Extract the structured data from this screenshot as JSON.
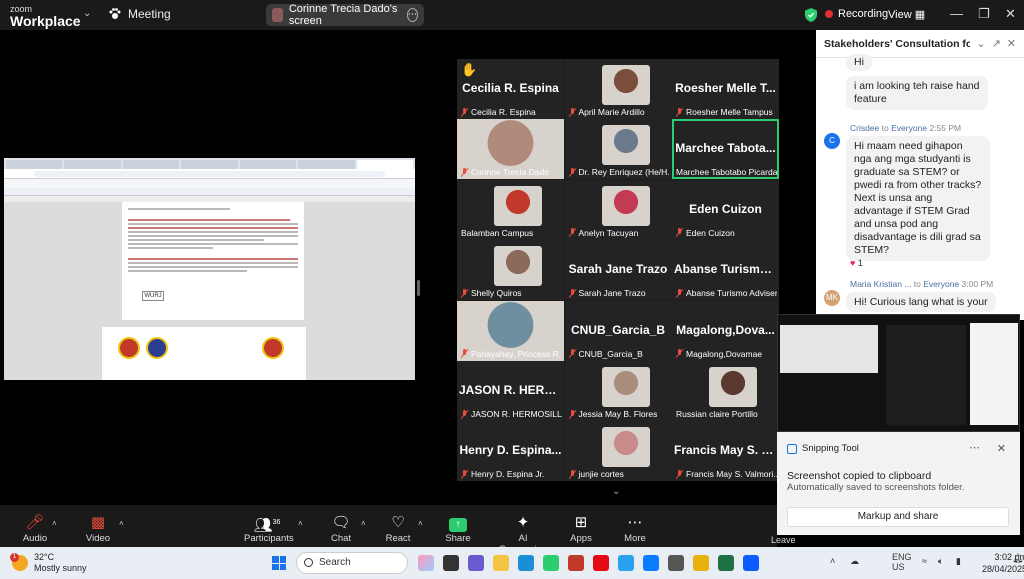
{
  "app": {
    "brand_line1": "zoom",
    "brand_line2": "Workplace",
    "meeting_label": "Meeting",
    "screen_share_label": "Corinne Trecia Dado's screen",
    "recording_label": "Recording",
    "view_label": "View"
  },
  "gallery": {
    "tiles": [
      {
        "display": "Cecilia R. Espina",
        "label": "Cecilia R. Espina",
        "hand": true,
        "muted": true
      },
      {
        "display": "",
        "label": "April Marie Ardillo",
        "photo_color": "#7a4e3b",
        "muted": true
      },
      {
        "display": "Roesher Melle T...",
        "label": "Roesher Melle Tampus",
        "muted": true
      },
      {
        "display": "",
        "label": "Corinne Trecia Dado",
        "photo_color": "#b08a7a",
        "full": true,
        "muted": true
      },
      {
        "display": "",
        "label": "Dr. Rey Enriquez (He/H...",
        "photo_color": "#6b7a8c",
        "muted": true
      },
      {
        "display": "Marchee Tabota...",
        "label": "Marchee Tabotabo Picardal",
        "active": true,
        "muted": false
      },
      {
        "display": "",
        "label": "Balamban Campus",
        "photo_color": "#c0392b",
        "muted": false
      },
      {
        "display": "",
        "label": "Anelyn Tacuyan",
        "photo_color": "#c23b52",
        "muted": true
      },
      {
        "display": "Eden Cuizon",
        "label": "Eden Cuizon",
        "muted": true
      },
      {
        "display": "",
        "label": "Shelly Quiros",
        "photo_color": "#8b6a5a",
        "muted": true
      },
      {
        "display": "Sarah Jane Trazo",
        "label": "Sarah Jane Trazo",
        "muted": true
      },
      {
        "display": "Abanse Turismo...",
        "label": "Abanse Turismo Adviser",
        "muted": true
      },
      {
        "display": "",
        "label": "Pahayahay, Princess R...",
        "photo_color": "#6f8fa0",
        "full": true,
        "muted": true
      },
      {
        "display": "CNUB_Garcia_B",
        "label": "CNUB_Garcia_B",
        "muted": true
      },
      {
        "display": "Magalong,Dova...",
        "label": "Magalong,Dovamae",
        "muted": true
      },
      {
        "display": "JASON R. HERM...",
        "label": "JASON R. HERMOSILLA",
        "muted": true
      },
      {
        "display": "",
        "label": "Jessia May B. Flores",
        "photo_color": "#a98c7c",
        "muted": true
      },
      {
        "display": "",
        "label": "Russian claire Portillo",
        "photo_color": "#5a3a2e",
        "muted": false
      },
      {
        "display": "Henry D. Espina...",
        "label": "Henry D. Espina Jr.",
        "muted": true
      },
      {
        "display": "",
        "label": "junjie cortes",
        "photo_color": "#c98a8a",
        "muted": true
      },
      {
        "display": "Francis May S. V...",
        "label": "Francis May S. Valmori...",
        "muted": true
      }
    ]
  },
  "chat": {
    "title": "Stakeholders' Consultation for C...",
    "messages": [
      {
        "text": "Hi"
      },
      {
        "text": "i am looking teh raise hand feature"
      },
      {
        "sender": "Crisdee",
        "to": "to",
        "recipient": "Everyone",
        "time": "2:55 PM",
        "avatar": "C",
        "avatar_color": "#1a73e8",
        "text": "Hi maam need gihapon nga ang mga studyanti is graduate sa STEM? or pwedi ra from other tracks? Next is unsa ang advantage if STEM Grad and unsa pod ang disadvantage is dili grad sa STEM?",
        "reaction": "1"
      },
      {
        "sender": "Maria Kristian ...",
        "to": "to",
        "recipient": "Everyone",
        "time": "3:00 PM",
        "avatar": "MK",
        "avatar_color": "#d4a373",
        "text": "Hi! Curious lang what is your"
      }
    ]
  },
  "snipping": {
    "app": "Snipping Tool",
    "title": "Screenshot copied to clipboard",
    "subtitle": "Automatically saved to screenshots folder.",
    "button": "Markup and share"
  },
  "controls": {
    "audio": "Audio",
    "video": "Video",
    "participants": "Participants",
    "participants_count": "36",
    "chat": "Chat",
    "react": "React",
    "share": "Share",
    "ai": "AI Companion",
    "apps": "Apps",
    "more": "More",
    "leave": "Leave"
  },
  "taskbar": {
    "temp": "32°C",
    "weather": "Mostly sunny",
    "weather_badge": "1",
    "search": "Search",
    "lang1": "ENG",
    "lang2": "US",
    "time": "3:02 pm",
    "date": "28/04/2025"
  },
  "doc": {
    "footer_logo": "WURJ"
  }
}
